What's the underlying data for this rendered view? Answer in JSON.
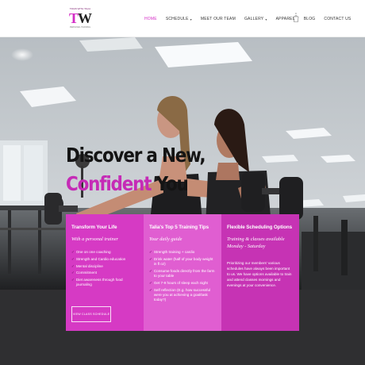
{
  "brand": {
    "logo_top": "TRAIN WITH TALIA",
    "logo_mark_a": "T",
    "logo_mark_b": "W",
    "logo_bottom": "PERSONAL TRAINING"
  },
  "nav": {
    "items": [
      {
        "label": "HOME",
        "active": true,
        "has_caret": false
      },
      {
        "label": "SCHEDULE",
        "active": false,
        "has_caret": true
      },
      {
        "label": "MEET OUR TEAM",
        "active": false,
        "has_caret": false
      },
      {
        "label": "GALLERY",
        "active": false,
        "has_caret": true
      },
      {
        "label": "APPAREL",
        "active": false,
        "has_caret": false
      },
      {
        "label": "BLOG",
        "active": false,
        "has_caret": false
      },
      {
        "label": "CONTACT US",
        "active": false,
        "has_caret": false
      }
    ],
    "cart_count": "0"
  },
  "hero": {
    "line1": "Discover a New,",
    "line2_accent": "Confident",
    "line2_rest": " You"
  },
  "cards": [
    {
      "title": "Transform Your Life",
      "subtitle": "With a personal trainer",
      "items": [
        "One on one coaching",
        "Strength and Cardio education",
        "Mental discipline",
        "Commitment",
        "Diet awareness through food journaling"
      ],
      "button": "VIEW CLASS SCHEDULE"
    },
    {
      "title": "Talia's Top 5 Training Tips",
      "subtitle": "Your daily guide",
      "items": [
        "Strength training + cardio",
        "Drink water (half of your body weight in fl oz)",
        "Consume foods directly from the farm to your table",
        "Get 7-9 hours of sleep each night",
        "Self reflection (E.g. how successful were you at achieving a goal/task today?)"
      ]
    },
    {
      "title": "Flexible Scheduling Options",
      "subtitle": "Training & classes available Monday - Saturday",
      "body": "Prioritizing our members' various schedules have always been important to us. We have options available to train and attend classes mornings and evenings at your convenience."
    }
  ],
  "colors": {
    "accent": "#d42bc5",
    "card1": "#d63ac4",
    "card2": "#e05ed1",
    "card3": "#c633b4",
    "dark_band": "#2f2f31"
  }
}
